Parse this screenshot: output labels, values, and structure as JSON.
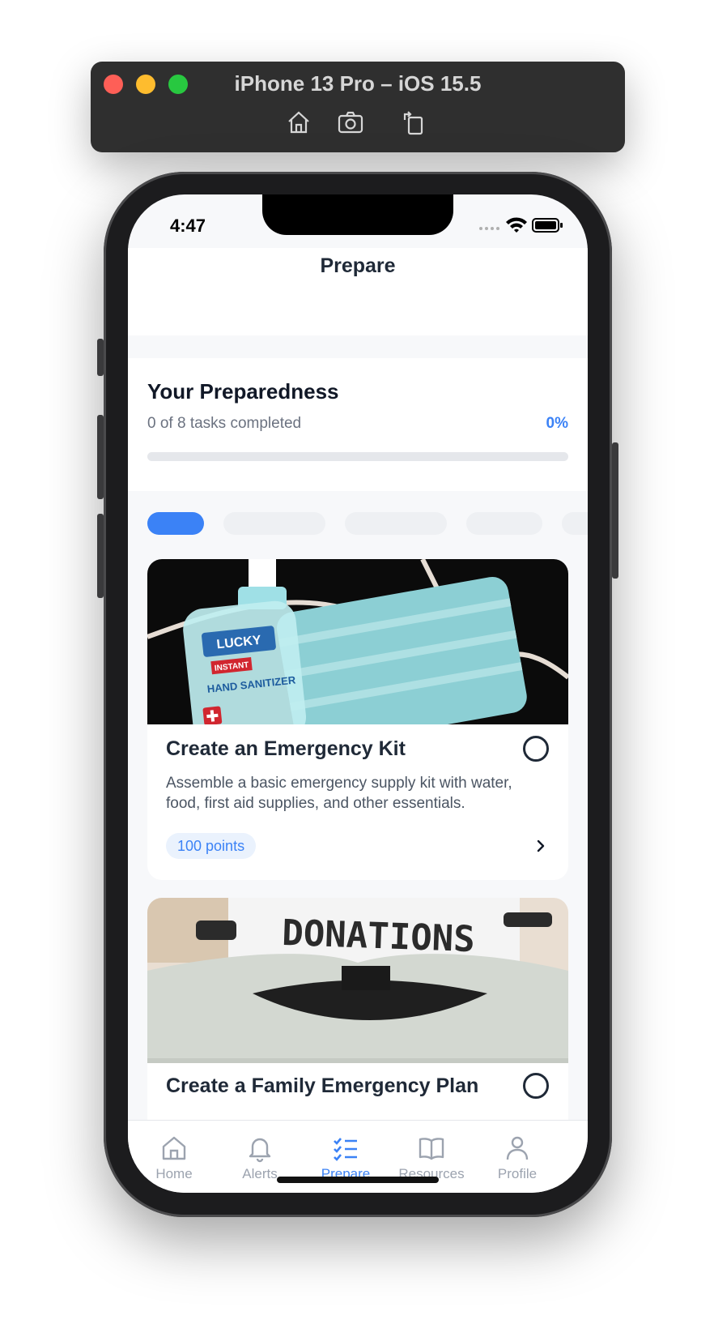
{
  "simulator": {
    "title": "iPhone 13 Pro – iOS 15.5",
    "toolbar": [
      "home-icon",
      "camera-icon",
      "rotate-icon"
    ]
  },
  "status_bar": {
    "time": "4:47"
  },
  "nav": {
    "title": "Prepare"
  },
  "preparedness": {
    "heading": "Your Preparedness",
    "summary": "0 of 8 tasks completed",
    "percent_label": "0%",
    "progress": 0
  },
  "accent_color": "#3b82f6",
  "tasks": [
    {
      "title": "Create an Emergency Kit",
      "description": "Assemble a basic emergency supply kit with water, food, first aid supplies, and other essentials.",
      "points": "100 points"
    },
    {
      "title": "Create a Family Emergency Plan",
      "image_text": "DONATIONS"
    }
  ],
  "tabbar": [
    {
      "label": "Home",
      "icon": "home-icon"
    },
    {
      "label": "Alerts",
      "icon": "bell-icon"
    },
    {
      "label": "Prepare",
      "icon": "checklist-icon",
      "active": true
    },
    {
      "label": "Resources",
      "icon": "book-icon"
    },
    {
      "label": "Profile",
      "icon": "person-icon"
    }
  ]
}
